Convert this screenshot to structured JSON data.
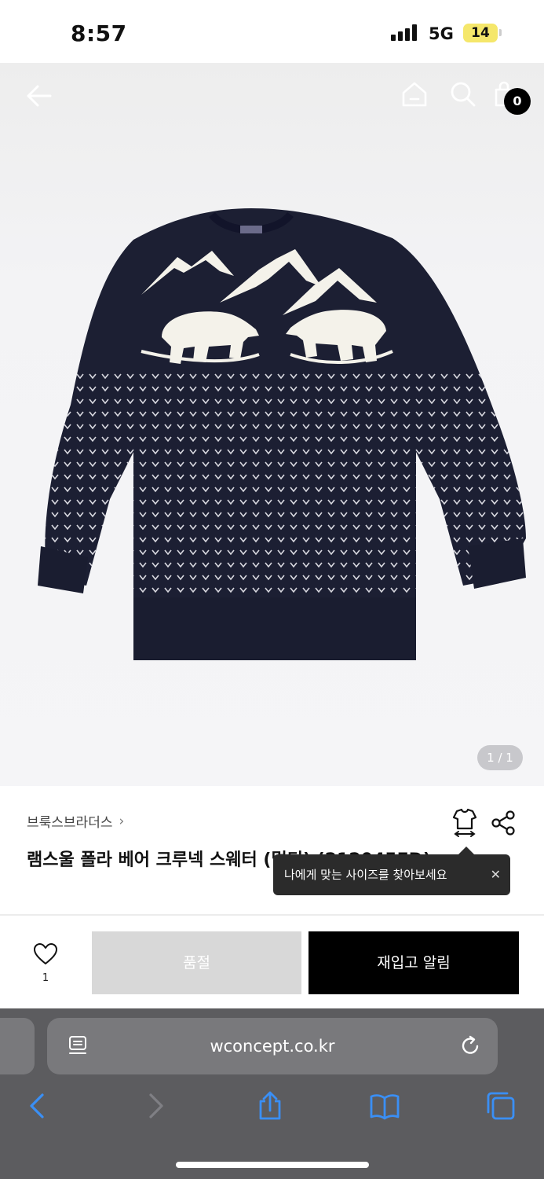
{
  "status_bar": {
    "time": "8:57",
    "network": "5G",
    "battery": "14"
  },
  "header": {
    "cart_count": "0"
  },
  "gallery": {
    "pager": "1 / 1"
  },
  "product": {
    "brand": "브룩스브라더스",
    "name": "램스울 폴라 베어 크루넥 스웨터 (멀티) (212045FD)"
  },
  "tooltip": {
    "text": "나에게 맞는 사이즈를 찾아보세요",
    "close": "✕"
  },
  "actions": {
    "wish_count": "1",
    "soldout_label": "품절",
    "restock_label": "재입고 알림"
  },
  "browser": {
    "url": "wconcept.co.kr"
  },
  "colors": {
    "sweater_navy": "#1c1f33",
    "accent_black": "#000000",
    "soldout_gray": "#d8d8d8",
    "ios_blue": "#3a8ff5",
    "battery_yellow": "#f5e76b"
  },
  "icons": [
    "back-arrow-icon",
    "home-icon",
    "search-icon",
    "cart-icon",
    "size-guide-icon",
    "share-icon",
    "heart-icon",
    "reader-icon",
    "reload-icon",
    "back-icon",
    "forward-icon",
    "share-sheet-icon",
    "bookmarks-icon",
    "tabs-icon"
  ]
}
